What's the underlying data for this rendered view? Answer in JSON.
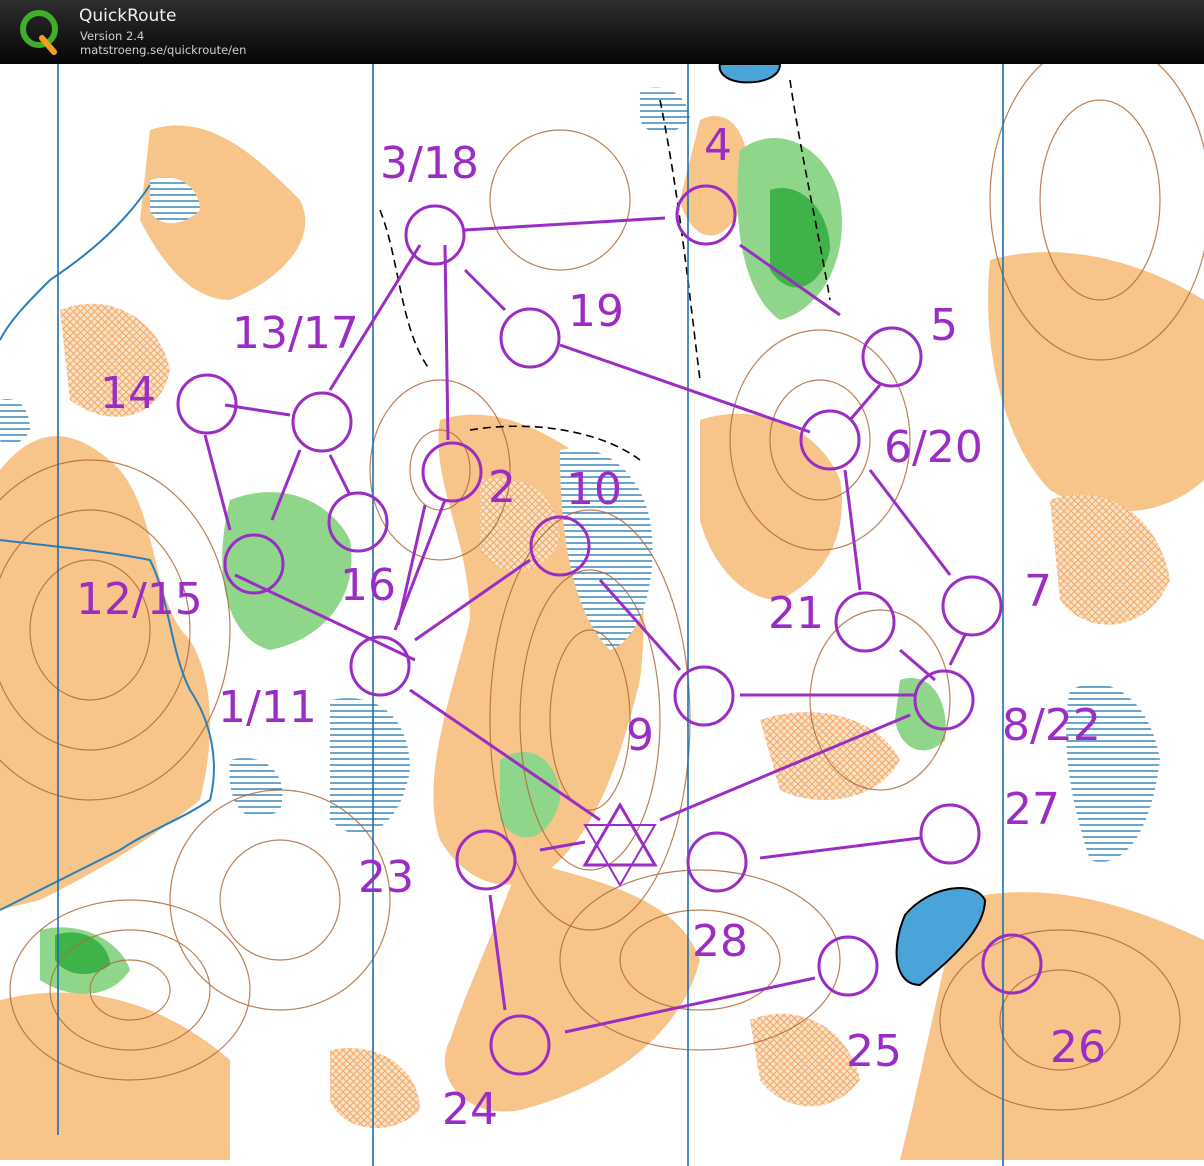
{
  "app": {
    "name": "QuickRoute",
    "version": "Version 2.4",
    "url": "matstroeng.se/quickroute/en",
    "logo_letter": "Q"
  },
  "course": {
    "color": "#9b2cc4",
    "start_symbol": "triangle-star",
    "labels": [
      {
        "id": "c3-18",
        "text": "3/18"
      },
      {
        "id": "c4",
        "text": "4"
      },
      {
        "id": "c19",
        "text": "19"
      },
      {
        "id": "c13-17",
        "text": "13/17"
      },
      {
        "id": "c5",
        "text": "5"
      },
      {
        "id": "c14",
        "text": "14"
      },
      {
        "id": "c6-20",
        "text": "6/20"
      },
      {
        "id": "c2",
        "text": "2"
      },
      {
        "id": "c10",
        "text": "10"
      },
      {
        "id": "c12-15",
        "text": "12/15"
      },
      {
        "id": "c16",
        "text": "16"
      },
      {
        "id": "c7",
        "text": "7"
      },
      {
        "id": "c21",
        "text": "21"
      },
      {
        "id": "c1-11",
        "text": "1/11"
      },
      {
        "id": "c9",
        "text": "9"
      },
      {
        "id": "c8-22",
        "text": "8/22"
      },
      {
        "id": "c27",
        "text": "27"
      },
      {
        "id": "c23",
        "text": "23"
      },
      {
        "id": "c28",
        "text": "28"
      },
      {
        "id": "c25",
        "text": "25"
      },
      {
        "id": "c26",
        "text": "26"
      },
      {
        "id": "c24",
        "text": "24"
      }
    ]
  },
  "map_colors": {
    "open_land": "#f7c48a",
    "forest_green": "#8fd68a",
    "dark_green": "#3fb34a",
    "marsh": "#2a7fb8",
    "water": "#4aa3d9",
    "contour": "#b06a3b",
    "meridian": "#1b6fb0"
  }
}
